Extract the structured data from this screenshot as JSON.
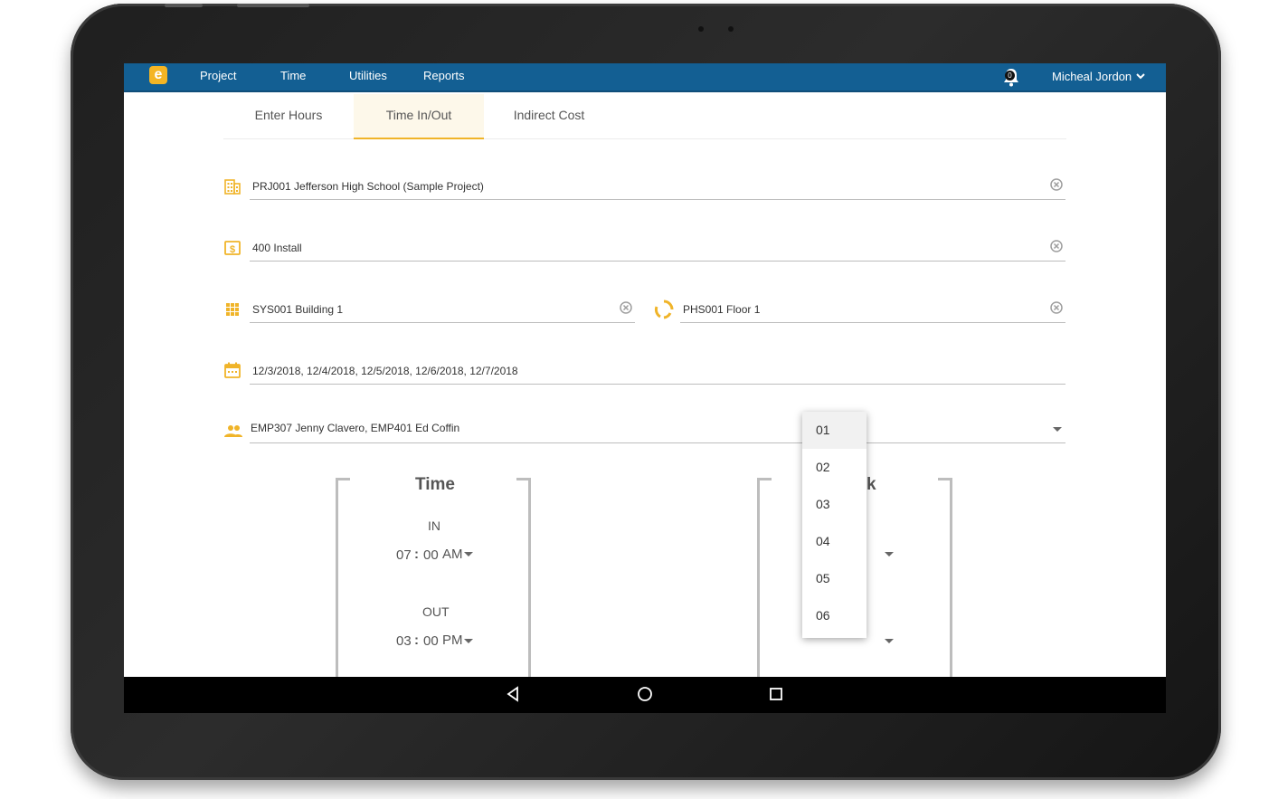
{
  "appbar": {
    "logo_letter": "e",
    "nav": [
      "Project",
      "Time",
      "Utilities",
      "Reports"
    ],
    "notification_count": "0",
    "user_name": "Micheal Jordon"
  },
  "tabs": [
    "Enter Hours",
    "Time In/Out",
    "Indirect Cost"
  ],
  "active_tab": "Time In/Out",
  "fields": {
    "project": "PRJ001 Jefferson High School (Sample Project)",
    "cost_code": "400 Install",
    "system": "SYS001 Building 1",
    "phase": "PHS001 Floor 1",
    "dates": "12/3/2018, 12/4/2018, 12/5/2018, 12/6/2018, 12/7/2018",
    "employees": "EMP307 Jenny Clavero, EMP401 Ed Coffin"
  },
  "time_panel": {
    "title": "Time",
    "in_label": "IN",
    "in_hour": "07",
    "in_minute": "00",
    "in_ampm": "AM",
    "out_label": "OUT",
    "out_hour": "03",
    "out_minute": "00",
    "out_ampm": "PM",
    "separator": ":"
  },
  "break_panel": {
    "title_visible": "k"
  },
  "hour_dropdown": {
    "options": [
      "01",
      "02",
      "03",
      "04",
      "05",
      "06"
    ],
    "highlighted": "01"
  },
  "colors": {
    "appbar": "#135f93",
    "accent": "#f0b429"
  }
}
